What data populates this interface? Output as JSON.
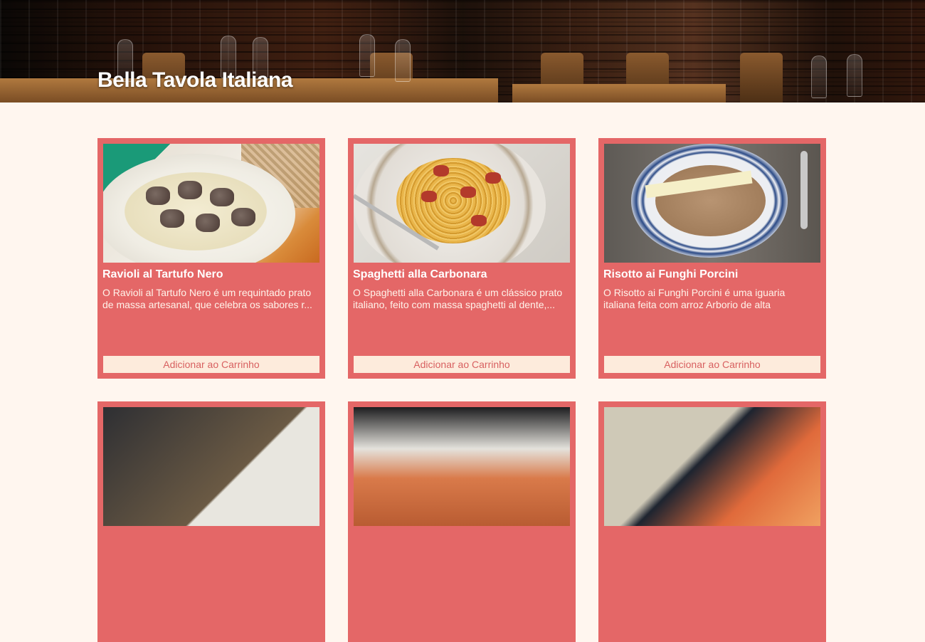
{
  "header": {
    "title": "Bella Tavola Italiana"
  },
  "menu": {
    "items": [
      {
        "name": "Ravioli al Tartufo Nero",
        "description": "O Ravioli al Tartufo Nero é um requintado prato de massa artesanal, que celebra os sabores r...",
        "button_label": "Adicionar ao Carrinho",
        "image_icon": "ravioli-dish-photo"
      },
      {
        "name": "Spaghetti alla Carbonara",
        "description": "O Spaghetti alla Carbonara é um clássico prato italiano, feito com massa spaghetti al dente,...",
        "button_label": "Adicionar ao Carrinho",
        "image_icon": "carbonara-dish-photo"
      },
      {
        "name": "Risotto ai Funghi Porcini",
        "description": "O Risotto ai Funghi Porcini é uma iguaria italiana feita com arroz Arborio de alta qualidade...",
        "button_label": "Adicionar ao Carrinho",
        "image_icon": "risotto-dish-photo"
      },
      {
        "image_icon": "meat-dish-photo"
      },
      {
        "image_icon": "rice-dish-photo"
      },
      {
        "image_icon": "seafood-dish-photo"
      }
    ]
  },
  "colors": {
    "background": "#fff6ef",
    "card": "#e46767",
    "button_bg": "#fdebdc",
    "button_text": "#d86060"
  }
}
